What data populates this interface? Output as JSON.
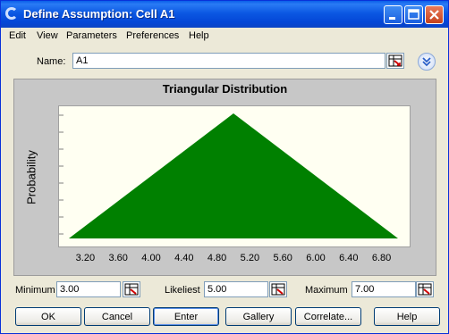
{
  "window": {
    "title": "Define Assumption: Cell A1",
    "minimize_icon": "minimize-icon",
    "maximize_icon": "maximize-icon",
    "close_icon": "close-icon"
  },
  "menu": {
    "items": [
      "Edit",
      "View",
      "Parameters",
      "Preferences",
      "Help"
    ]
  },
  "name": {
    "label": "Name:",
    "value": "A1"
  },
  "chart_data": {
    "type": "area",
    "title": "Triangular Distribution",
    "xlabel": "",
    "ylabel": "Probability",
    "x_ticks": [
      "3.20",
      "3.60",
      "4.00",
      "4.40",
      "4.80",
      "5.20",
      "5.60",
      "6.00",
      "6.40",
      "6.80"
    ],
    "xlim": [
      3.0,
      7.0
    ],
    "x": [
      3.0,
      5.0,
      7.0
    ],
    "y": [
      0,
      1,
      0
    ],
    "fill_color": "#008000",
    "plot_background": "#fffff2"
  },
  "params": {
    "minimum_label": "Minimum",
    "minimum_value": "3.00",
    "likeliest_label": "Likeliest",
    "likeliest_value": "5.00",
    "maximum_label": "Maximum",
    "maximum_value": "7.00"
  },
  "buttons": {
    "ok": "OK",
    "cancel": "Cancel",
    "enter": "Enter",
    "gallery": "Gallery",
    "correlate": "Correlate...",
    "help": "Help"
  }
}
